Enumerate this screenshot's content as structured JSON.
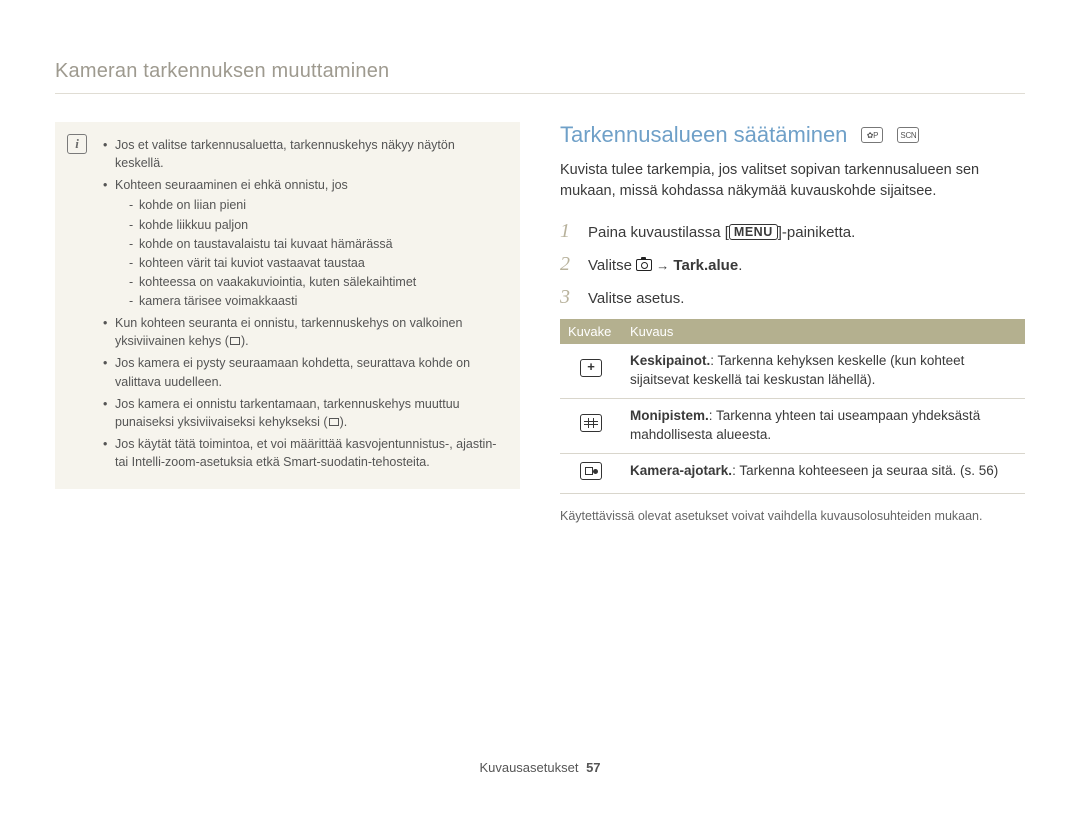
{
  "header": "Kameran tarkennuksen muuttaminen",
  "infobox": {
    "bullets": [
      {
        "text": "Jos et valitse tarkennusaluetta, tarkennuskehys näkyy näytön keskellä."
      },
      {
        "text": "Kohteen seuraaminen ei ehkä onnistu, jos",
        "sub": [
          "kohde on liian pieni",
          "kohde liikkuu paljon",
          "kohde on taustavalaistu tai kuvaat hämärässä",
          "kohteen värit tai kuviot vastaavat taustaa",
          "kohteessa on vaakakuviointia, kuten sälekaihtimet",
          "kamera tärisee voimakkaasti"
        ]
      },
      {
        "text_pre": "Kun kohteen seuranta ei onnistu, tarkennuskehys on valkoinen yksiviivainen kehys (",
        "text_post": ")."
      },
      {
        "text": "Jos kamera ei pysty seuraamaan kohdetta, seurattava kohde on valittava uudelleen."
      },
      {
        "text_pre": "Jos kamera ei onnistu tarkentamaan, tarkennuskehys muuttuu punaiseksi yksiviivaiseksi kehykseksi (",
        "text_post": ")."
      },
      {
        "text": "Jos käytät tätä toimintoa, et voi määrittää kasvojentunnistus-, ajastin- tai Intelli-zoom-asetuksia etkä Smart-suodatin-tehosteita."
      }
    ]
  },
  "section": {
    "title": "Tarkennusalueen säätäminen",
    "modes": [
      "P",
      "SCN"
    ],
    "intro": "Kuvista tulee tarkempia, jos valitset sopivan tarkennusalueen sen mukaan, missä kohdassa näkymää kuvauskohde sijaitsee.",
    "steps": {
      "s1_pre": "Paina kuvaustilassa [",
      "s1_btn": "MENU",
      "s1_post": "]-painiketta.",
      "s2_pre": "Valitse ",
      "s2_arrow": "→",
      "s2_bold": "Tark.alue",
      "s2_post": ".",
      "s3": "Valitse asetus."
    },
    "table": {
      "h1": "Kuvake",
      "h2": "Kuvaus",
      "rows": [
        {
          "icon": "center-af-icon",
          "bold": "Keskipainot.",
          "text": ": Tarkenna kehyksen keskelle (kun kohteet sijaitsevat keskellä tai keskustan lähellä)."
        },
        {
          "icon": "multi-af-icon",
          "bold": "Monipistem.",
          "text": ": Tarkenna yhteen tai useampaan yhdeksästä mahdollisesta alueesta."
        },
        {
          "icon": "tracking-af-icon",
          "bold": "Kamera-ajotark.",
          "text": ": Tarkenna kohteeseen ja seuraa sitä. (s. 56)"
        }
      ]
    },
    "note": "Käytettävissä olevat asetukset voivat vaihdella kuvausolosuhteiden mukaan."
  },
  "footer": {
    "label": "Kuvausasetukset",
    "page": "57"
  }
}
